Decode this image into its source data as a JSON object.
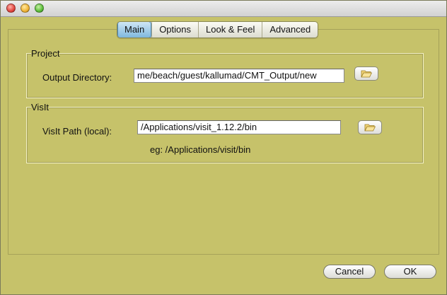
{
  "tabs": [
    {
      "label": "Main",
      "active": true
    },
    {
      "label": "Options",
      "active": false
    },
    {
      "label": "Look & Feel",
      "active": false
    },
    {
      "label": "Advanced",
      "active": false
    }
  ],
  "project": {
    "title": "Project",
    "output_label": "Output Directory:",
    "output_value": "me/beach/guest/kallumad/CMT_Output/new"
  },
  "visit": {
    "title": "VisIt",
    "path_label": "VisIt Path (local):",
    "path_value": "/Applications/visit_1.12.2/bin",
    "hint": "eg: /Applications/visit/bin"
  },
  "buttons": {
    "cancel": "Cancel",
    "ok": "OK"
  },
  "icons": {
    "browse": "folder-open-icon"
  },
  "colors": {
    "background": "#c6c26a",
    "active_tab": "#7fb8de"
  }
}
